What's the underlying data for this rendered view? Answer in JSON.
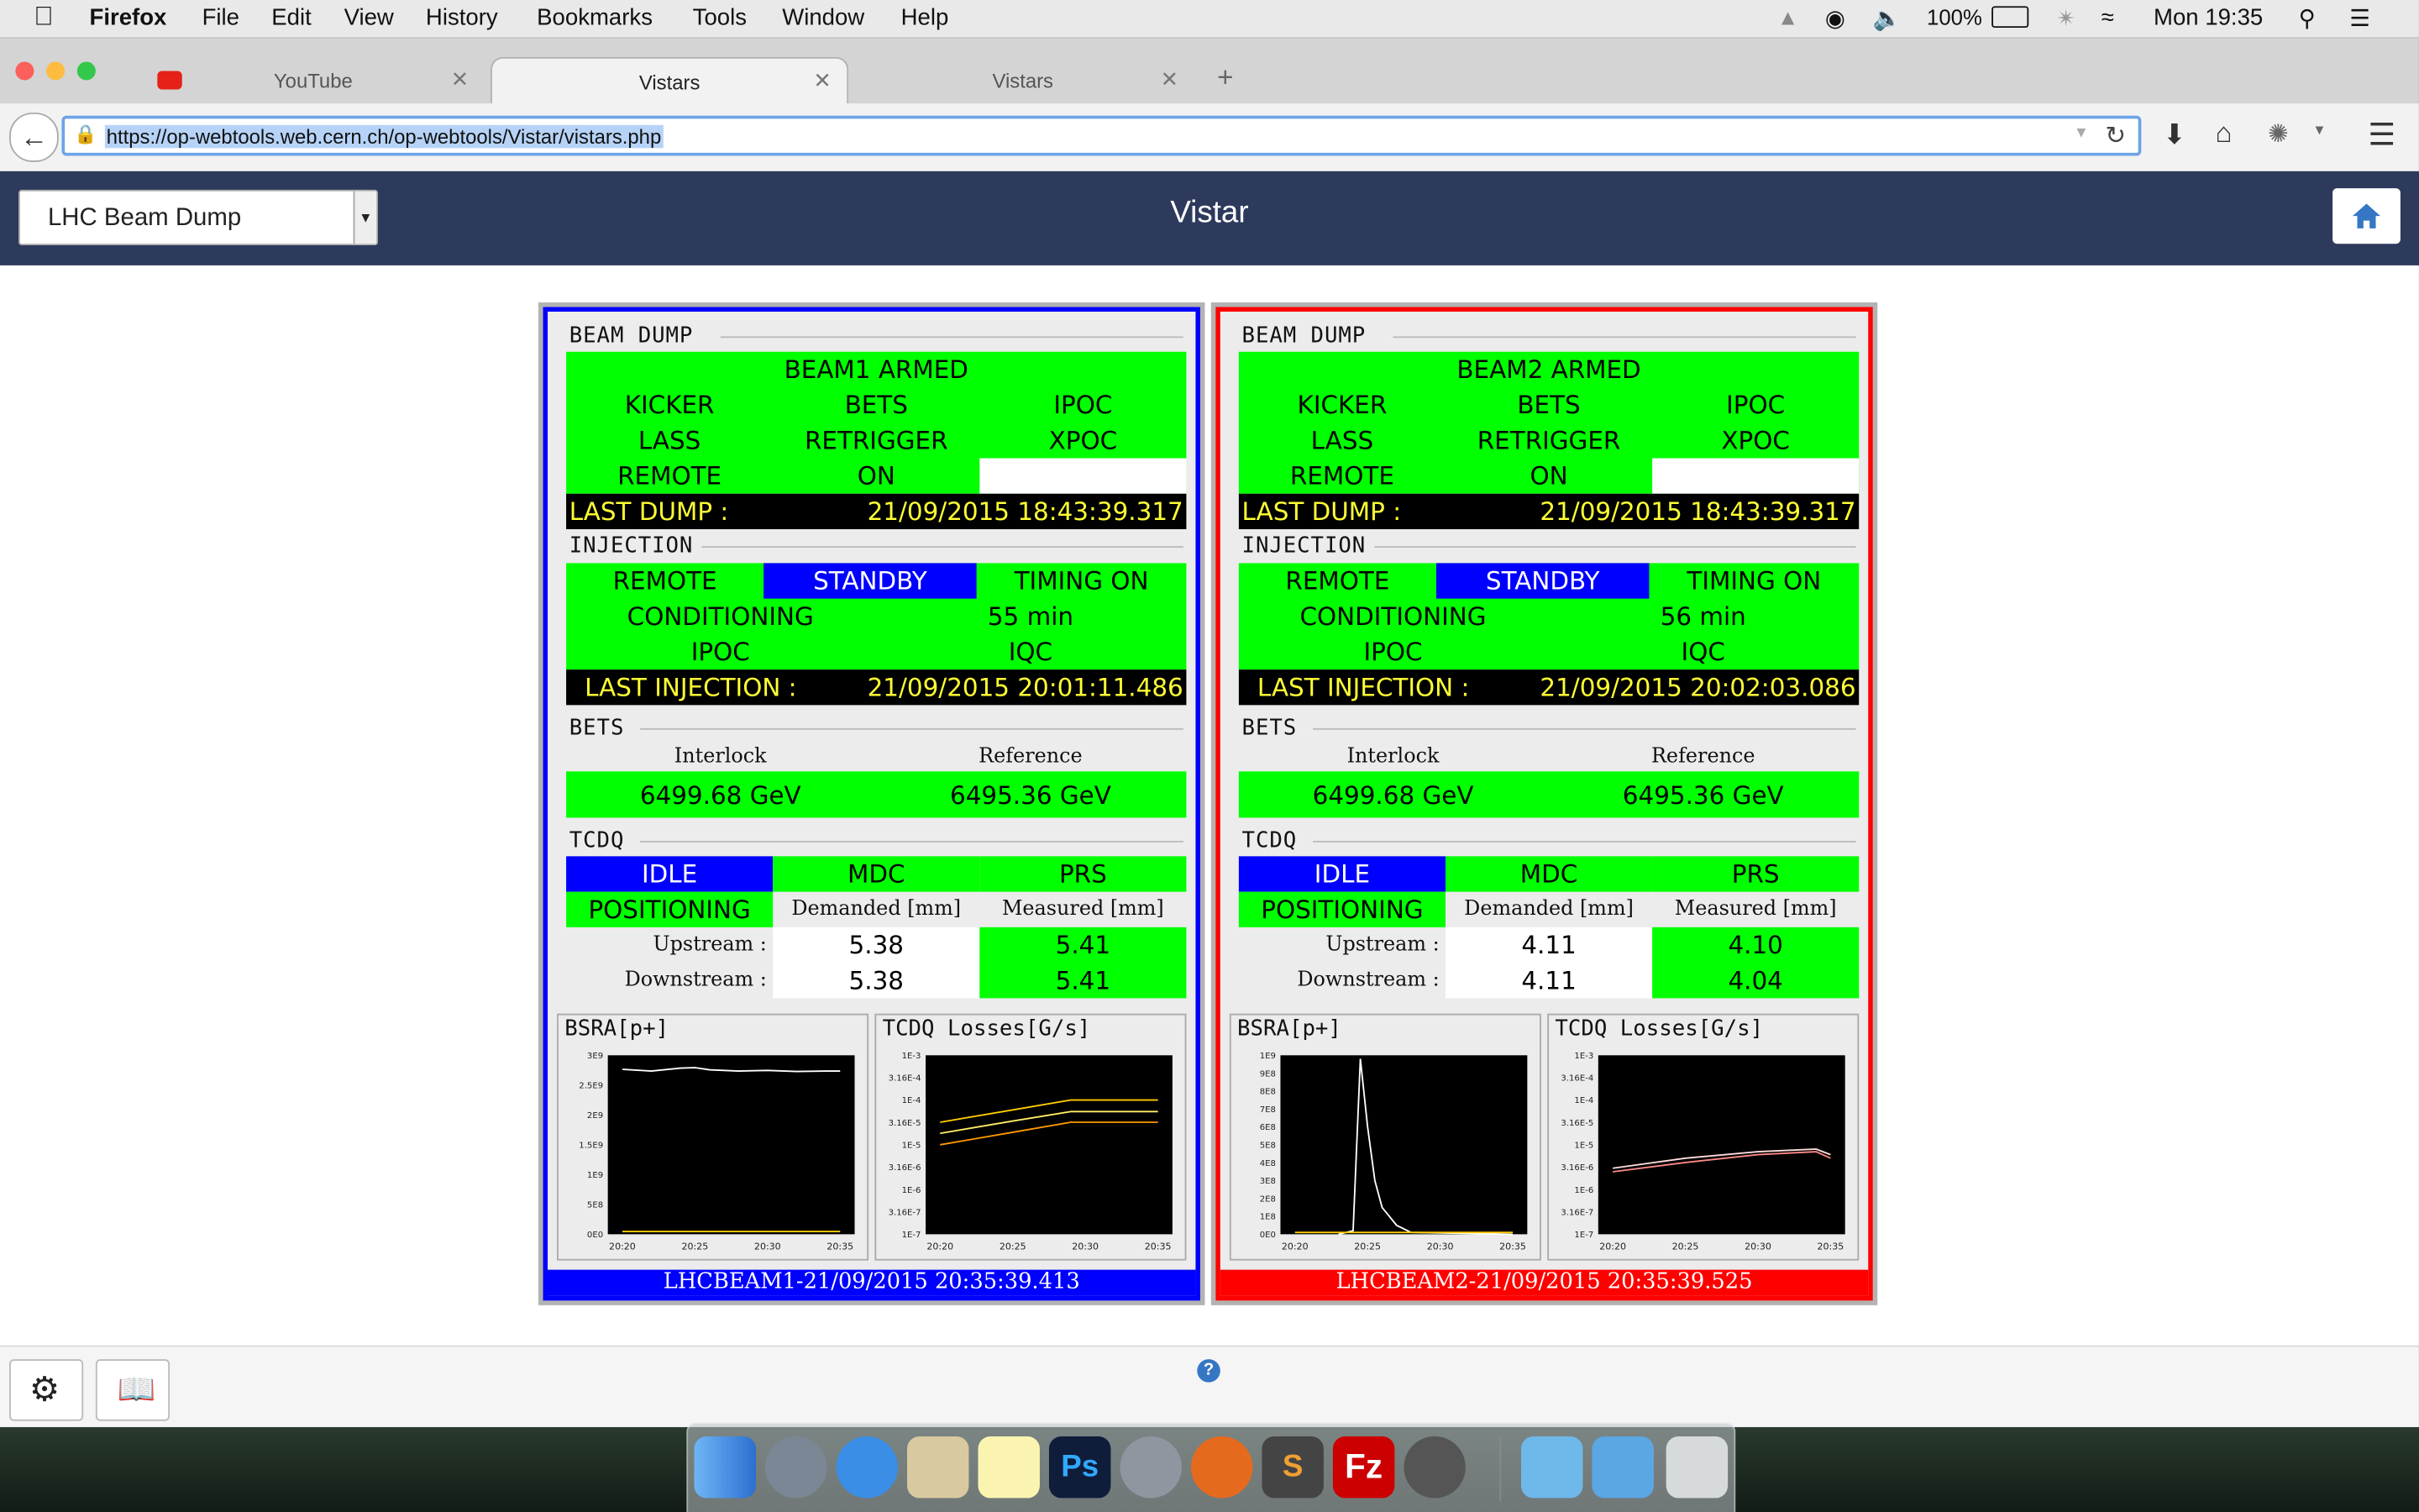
{
  "menubar": {
    "app": "Firefox",
    "items": [
      "File",
      "Edit",
      "View",
      "History",
      "Bookmarks",
      "Tools",
      "Window",
      "Help"
    ],
    "battery": "100%",
    "clock": "Mon 19:35"
  },
  "tabs": [
    {
      "label": "YouTube"
    },
    {
      "label": "Vistars"
    },
    {
      "label": "Vistars"
    }
  ],
  "new_tab": "+",
  "url": "https://op-webtools.web.cern.ch/op-webtools/Vistar/vistars.php",
  "app": {
    "select_value": "LHC Beam Dump",
    "title": "Vistar"
  },
  "beams": [
    {
      "color": "#0000ff",
      "beam_dump": {
        "title": "BEAM DUMP",
        "armed": "BEAM1 ARMED",
        "row1": [
          "KICKER",
          "BETS",
          "IPOC"
        ],
        "row2": [
          "LASS",
          "RETRIGGER",
          "XPOC"
        ],
        "row3": [
          "REMOTE",
          "ON"
        ],
        "last_dump_label": "LAST DUMP :",
        "last_dump_time": "21/09/2015 18:43:39.317"
      },
      "injection": {
        "title": "INJECTION",
        "remote": "REMOTE",
        "standby": "STANDBY",
        "timing": "TIMING ON",
        "conditioning": "CONDITIONING",
        "minutes": "55 min",
        "ipoc": "IPOC",
        "iqc": "IQC",
        "last_label": "LAST INJECTION :",
        "last_time": "21/09/2015 20:01:11.486"
      },
      "bets": {
        "title": "BETS",
        "interlock_label": "Interlock",
        "reference_label": "Reference",
        "interlock": "6499.68 GeV",
        "reference": "6495.36 GeV"
      },
      "tcdq": {
        "title": "TCDQ",
        "idle": "IDLE",
        "mdc": "MDC",
        "prs": "PRS",
        "positioning": "POSITIONING",
        "demanded_label": "Demanded [mm]",
        "measured_label": "Measured [mm]",
        "upstream_label": "Upstream :",
        "downstream_label": "Downstream :",
        "upstream_demanded": "5.38",
        "upstream_measured": "5.41",
        "downstream_demanded": "5.38",
        "downstream_measured": "5.41"
      },
      "plots": {
        "bsra_title": "BSRA[p+]",
        "losses_title": "TCDQ Losses[G/s]"
      },
      "footer": "LHCBEAM1-21/09/2015 20:35:39.413"
    },
    {
      "color": "#ff0000",
      "beam_dump": {
        "title": "BEAM DUMP",
        "armed": "BEAM2 ARMED",
        "row1": [
          "KICKER",
          "BETS",
          "IPOC"
        ],
        "row2": [
          "LASS",
          "RETRIGGER",
          "XPOC"
        ],
        "row3": [
          "REMOTE",
          "ON"
        ],
        "last_dump_label": "LAST DUMP :",
        "last_dump_time": "21/09/2015 18:43:39.317"
      },
      "injection": {
        "title": "INJECTION",
        "remote": "REMOTE",
        "standby": "STANDBY",
        "timing": "TIMING ON",
        "conditioning": "CONDITIONING",
        "minutes": "56 min",
        "ipoc": "IPOC",
        "iqc": "IQC",
        "last_label": "LAST INJECTION :",
        "last_time": "21/09/2015 20:02:03.086"
      },
      "bets": {
        "title": "BETS",
        "interlock_label": "Interlock",
        "reference_label": "Reference",
        "interlock": "6499.68 GeV",
        "reference": "6495.36 GeV"
      },
      "tcdq": {
        "title": "TCDQ",
        "idle": "IDLE",
        "mdc": "MDC",
        "prs": "PRS",
        "positioning": "POSITIONING",
        "demanded_label": "Demanded [mm]",
        "measured_label": "Measured [mm]",
        "upstream_label": "Upstream :",
        "downstream_label": "Downstream :",
        "upstream_demanded": "4.11",
        "upstream_measured": "4.10",
        "downstream_demanded": "4.11",
        "downstream_measured": "4.04"
      },
      "plots": {
        "bsra_title": "BSRA[p+]",
        "losses_title": "TCDQ Losses[G/s]"
      },
      "footer": "LHCBEAM2-21/09/2015 20:35:39.525"
    }
  ],
  "chart_data": [
    {
      "type": "line",
      "title": "BSRA[p+]",
      "panel": "LHCBEAM1",
      "x_ticks": [
        "20:20",
        "20:25",
        "20:30",
        "20:35"
      ],
      "y_ticks": [
        "0E0",
        "5E8",
        "1E9",
        "1.5E9",
        "2E9",
        "2.5E9",
        "3E9"
      ],
      "ylim": [
        0,
        3200000000.0
      ],
      "series": [
        {
          "color": "#ffffff",
          "x": [
            "20:20",
            "20:22",
            "20:24",
            "20:25",
            "20:26",
            "20:28",
            "20:30",
            "20:32",
            "20:34",
            "20:35"
          ],
          "values": [
            2950000000.0,
            2920000000.0,
            2970000000.0,
            2980000000.0,
            2940000000.0,
            2920000000.0,
            2930000000.0,
            2910000000.0,
            2920000000.0,
            2920000000.0
          ]
        },
        {
          "color": "#ffcc00",
          "x": [
            "20:20",
            "20:35"
          ],
          "values": [
            50000000.0,
            50000000.0
          ]
        }
      ]
    },
    {
      "type": "line",
      "title": "TCDQ Losses[G/s]",
      "panel": "LHCBEAM1",
      "log_scale": true,
      "x_ticks": [
        "20:20",
        "20:25",
        "20:30",
        "20:35"
      ],
      "y_ticks": [
        "1E-3",
        "3.16E-4",
        "1E-4",
        "3.16E-5",
        "1E-5",
        "3.16E-6",
        "1E-6",
        "3.16E-7",
        "1E-7"
      ],
      "series": [
        {
          "color": "#ffcc00",
          "x": [
            "20:20",
            "20:25",
            "20:29",
            "20:35"
          ],
          "values": [
            3.2e-05,
            6e-05,
            0.0001,
            0.0001
          ]
        },
        {
          "color": "#ffee66",
          "x": [
            "20:20",
            "20:25",
            "20:29",
            "20:35"
          ],
          "values": [
            1.8e-05,
            3.4e-05,
            5.5e-05,
            5.5e-05
          ]
        },
        {
          "color": "#ff9900",
          "x": [
            "20:20",
            "20:25",
            "20:29",
            "20:35"
          ],
          "values": [
            1e-05,
            1.9e-05,
            3.2e-05,
            3.2e-05
          ]
        }
      ]
    },
    {
      "type": "line",
      "title": "BSRA[p+]",
      "panel": "LHCBEAM2",
      "x_ticks": [
        "20:20",
        "20:25",
        "20:30",
        "20:35"
      ],
      "y_ticks": [
        "0E0",
        "1E8",
        "2E8",
        "3E8",
        "4E8",
        "5E8",
        "6E8",
        "7E8",
        "8E8",
        "9E8",
        "1E9"
      ],
      "ylim": [
        0,
        1000000000.0
      ],
      "series": [
        {
          "color": "#ffffff",
          "x": [
            "20:23",
            "20:24",
            "20:24.5",
            "20:25",
            "20:25.5",
            "20:26",
            "20:27",
            "20:28",
            "20:35"
          ],
          "values": [
            0,
            20000000.0,
            980000000.0,
            600000000.0,
            300000000.0,
            150000000.0,
            50000000.0,
            10000000.0,
            0
          ]
        },
        {
          "color": "#ffcc00",
          "x": [
            "20:20",
            "20:35"
          ],
          "values": [
            10000000.0,
            10000000.0
          ]
        }
      ]
    },
    {
      "type": "line",
      "title": "TCDQ Losses[G/s]",
      "panel": "LHCBEAM2",
      "log_scale": true,
      "x_ticks": [
        "20:20",
        "20:25",
        "20:30",
        "20:35"
      ],
      "y_ticks": [
        "1E-3",
        "3.16E-4",
        "1E-4",
        "3.16E-5",
        "1E-5",
        "3.16E-6",
        "1E-6",
        "3.16E-7",
        "1E-7"
      ],
      "series": [
        {
          "color": "#ffdddd",
          "x": [
            "20:20",
            "20:25",
            "20:30",
            "20:34",
            "20:35"
          ],
          "values": [
            3e-06,
            5e-06,
            7e-06,
            8e-06,
            6e-06
          ]
        },
        {
          "color": "#ff8888",
          "x": [
            "20:20",
            "20:25",
            "20:30",
            "20:34",
            "20:35"
          ],
          "values": [
            2.5e-06,
            4e-06,
            6e-06,
            7e-06,
            5e-06
          ]
        }
      ]
    }
  ]
}
